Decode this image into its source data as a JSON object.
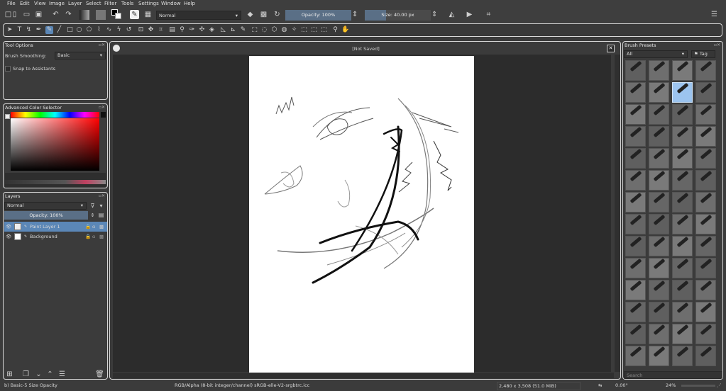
{
  "menu": [
    "File",
    "Edit",
    "View",
    "Image",
    "Layer",
    "Select",
    "Filter",
    "Tools",
    "Settings",
    "Window",
    "Help"
  ],
  "toolbar": {
    "blend_mode": "Normal",
    "opacity_label": "Opacity: 100%",
    "size_label": "Size: 40.00 px"
  },
  "tool_options": {
    "title": "Tool Options",
    "smoothing_label": "Brush Smoothing:",
    "smoothing_value": "Basic",
    "snap_label": "Snap to Assistants"
  },
  "color_selector": {
    "title": "Advanced Color Selector"
  },
  "layers": {
    "title": "Layers",
    "blend_mode": "Normal",
    "opacity_label": "Opacity:  100%",
    "items": [
      {
        "name": "Paint Layer 1",
        "selected": true
      },
      {
        "name": "Background",
        "selected": false
      }
    ]
  },
  "canvas": {
    "title": "[Not Saved]",
    "close_glyph": "✕"
  },
  "brush_presets": {
    "title": "Brush Presets",
    "filter": "All",
    "tag_label": "Tag",
    "search_placeholder": "Search",
    "selected_index": 6
  },
  "status": {
    "brush": "b) Basic-5 Size Opacity",
    "color_info": "RGB/Alpha (8-bit integer/channel)  sRGB-elle-V2-srgbtrc.icc",
    "dimensions": "2,480 x 3,508 (51.0 MiB)",
    "rotation": "0.00°",
    "zoom": "24%"
  },
  "colors": {
    "accent": "#5b87b7",
    "panel_bg": "#3b3b3b",
    "canvas_bg": "#2c2c2c"
  }
}
